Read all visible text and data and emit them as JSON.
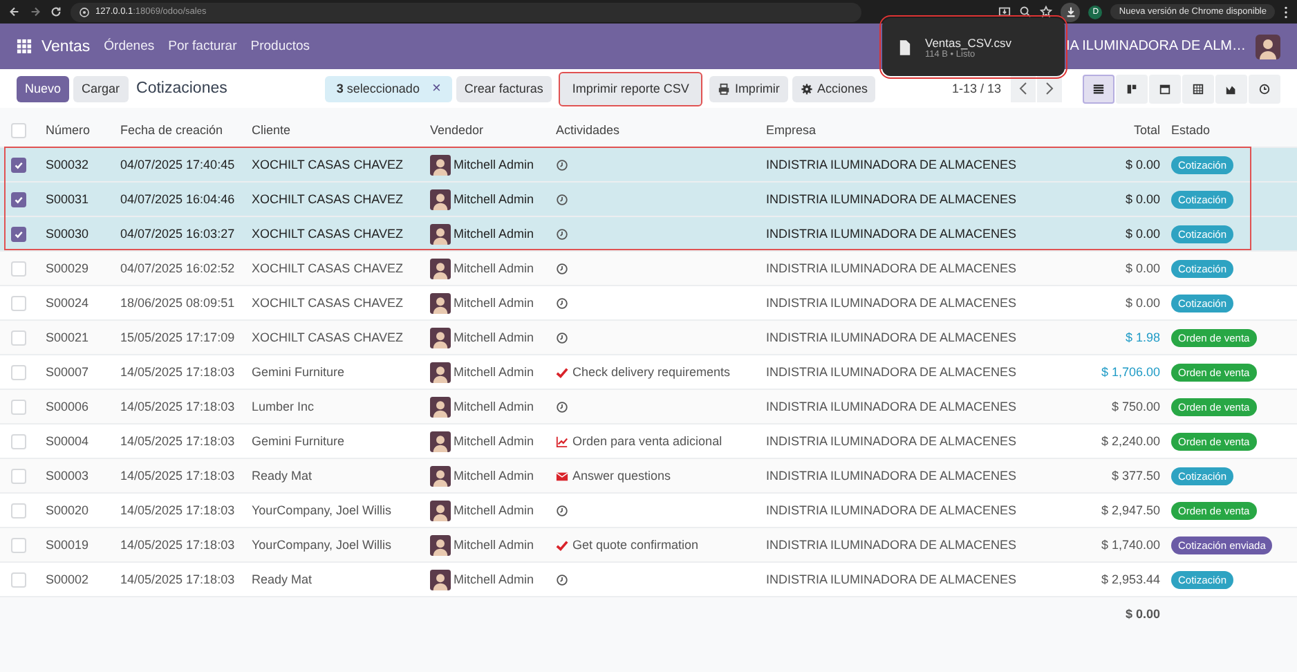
{
  "browser": {
    "url_host": "127.0.0.1",
    "url_path": ":18069/odoo/sales",
    "profile_initial": "D",
    "update_notice": "Nueva versión de Chrome disponible"
  },
  "download_popup": {
    "file_name": "Ventas_CSV.csv",
    "details": "114 B • Listo",
    "highlight": true
  },
  "navbar": {
    "app": "Ventas",
    "menu": [
      "Órdenes",
      "Por facturar",
      "Productos"
    ],
    "company": "IA ILUMINADORA DE ALM…"
  },
  "control_panel": {
    "buttons": [
      {
        "label": "Nuevo",
        "kind": "primary"
      },
      {
        "label": "Cargar",
        "kind": "secondary"
      }
    ],
    "title": "Cotizaciones",
    "selection": "**3** seleccionado",
    "clear": "×",
    "actions": [
      {
        "label": "Crear facturas",
        "kind": "plain",
        "highlight": false
      },
      {
        "label": "Imprimir reporte CSV",
        "kind": "plain",
        "highlight": true
      },
      {
        "label": "Imprimir",
        "kind": "print",
        "highlight": false
      },
      {
        "label": "Acciones",
        "kind": "menu",
        "highlight": false
      }
    ],
    "pager": "1-13 / 13",
    "views": [
      {
        "kind": "list",
        "selected": true
      },
      {
        "kind": "kanban",
        "selected": false
      },
      {
        "kind": "calendar",
        "selected": false
      },
      {
        "kind": "pivot",
        "selected": false
      },
      {
        "kind": "graph",
        "selected": false
      },
      {
        "kind": "activity",
        "selected": false
      }
    ]
  },
  "table": {
    "columns": [
      "Número",
      "Fecha de creación",
      "Cliente",
      "Vendedor",
      "Actividades",
      "Empresa",
      "Total",
      "Estado"
    ],
    "highlight_selected": true,
    "all_selected": false,
    "rows": [
      {
        "selected": true,
        "number": "S00032",
        "date": "04/07/2025 17:40:45",
        "customer": "XOCHILT CASAS CHAVEZ",
        "salesperson": "Mitchell Admin",
        "activity": {
          "kind": "clock"
        },
        "company": "INDISTRIA ILUMINADORA DE ALMACENES",
        "total": "$ 0.00",
        "total_emphasis": false,
        "status": {
          "label": "Cotización",
          "color": "#2ea3c2"
        }
      },
      {
        "selected": true,
        "number": "S00031",
        "date": "04/07/2025 16:04:46",
        "customer": "XOCHILT CASAS CHAVEZ",
        "salesperson": "Mitchell Admin",
        "activity": {
          "kind": "clock"
        },
        "company": "INDISTRIA ILUMINADORA DE ALMACENES",
        "total": "$ 0.00",
        "total_emphasis": false,
        "status": {
          "label": "Cotización",
          "color": "#2ea3c2"
        }
      },
      {
        "selected": true,
        "number": "S00030",
        "date": "04/07/2025 16:03:27",
        "customer": "XOCHILT CASAS CHAVEZ",
        "salesperson": "Mitchell Admin",
        "activity": {
          "kind": "clock"
        },
        "company": "INDISTRIA ILUMINADORA DE ALMACENES",
        "total": "$ 0.00",
        "total_emphasis": false,
        "status": {
          "label": "Cotización",
          "color": "#2ea3c2"
        }
      },
      {
        "selected": false,
        "number": "S00029",
        "date": "04/07/2025 16:02:52",
        "customer": "XOCHILT CASAS CHAVEZ",
        "salesperson": "Mitchell Admin",
        "activity": {
          "kind": "clock"
        },
        "company": "INDISTRIA ILUMINADORA DE ALMACENES",
        "total": "$ 0.00",
        "total_emphasis": false,
        "status": {
          "label": "Cotización",
          "color": "#2ea3c2"
        }
      },
      {
        "selected": false,
        "number": "S00024",
        "date": "18/06/2025 08:09:51",
        "customer": "XOCHILT CASAS CHAVEZ",
        "salesperson": "Mitchell Admin",
        "activity": {
          "kind": "clock"
        },
        "company": "INDISTRIA ILUMINADORA DE ALMACENES",
        "total": "$ 0.00",
        "total_emphasis": false,
        "status": {
          "label": "Cotización",
          "color": "#2ea3c2"
        }
      },
      {
        "selected": false,
        "number": "S00021",
        "date": "15/05/2025 17:17:09",
        "customer": "XOCHILT CASAS CHAVEZ",
        "salesperson": "Mitchell Admin",
        "activity": {
          "kind": "clock"
        },
        "company": "INDISTRIA ILUMINADORA DE ALMACENES",
        "total": "$ 1.98",
        "total_emphasis": true,
        "status": {
          "label": "Orden de venta",
          "color": "#28a745"
        }
      },
      {
        "selected": false,
        "number": "S00007",
        "date": "14/05/2025 17:18:03",
        "customer": "Gemini Furniture",
        "salesperson": "Mitchell Admin",
        "activity": {
          "kind": "check",
          "text": "Check delivery requirements"
        },
        "company": "INDISTRIA ILUMINADORA DE ALMACENES",
        "total": "$ 1,706.00",
        "total_emphasis": true,
        "status": {
          "label": "Orden de venta",
          "color": "#28a745"
        }
      },
      {
        "selected": false,
        "number": "S00006",
        "date": "14/05/2025 17:18:03",
        "customer": "Lumber Inc",
        "salesperson": "Mitchell Admin",
        "activity": {
          "kind": "clock"
        },
        "company": "INDISTRIA ILUMINADORA DE ALMACENES",
        "total": "$ 750.00",
        "total_emphasis": false,
        "status": {
          "label": "Orden de venta",
          "color": "#28a745"
        }
      },
      {
        "selected": false,
        "number": "S00004",
        "date": "14/05/2025 17:18:03",
        "customer": "Gemini Furniture",
        "salesperson": "Mitchell Admin",
        "activity": {
          "kind": "chart",
          "text": "Orden para venta adicional"
        },
        "company": "INDISTRIA ILUMINADORA DE ALMACENES",
        "total": "$ 2,240.00",
        "total_emphasis": false,
        "status": {
          "label": "Orden de venta",
          "color": "#28a745"
        }
      },
      {
        "selected": false,
        "number": "S00003",
        "date": "14/05/2025 17:18:03",
        "customer": "Ready Mat",
        "salesperson": "Mitchell Admin",
        "activity": {
          "kind": "mail",
          "text": "Answer questions"
        },
        "company": "INDISTRIA ILUMINADORA DE ALMACENES",
        "total": "$ 377.50",
        "total_emphasis": false,
        "status": {
          "label": "Cotización",
          "color": "#2ea3c2"
        }
      },
      {
        "selected": false,
        "number": "S00020",
        "date": "14/05/2025 17:18:03",
        "customer": "YourCompany, Joel Willis",
        "salesperson": "Mitchell Admin",
        "activity": {
          "kind": "clock"
        },
        "company": "INDISTRIA ILUMINADORA DE ALMACENES",
        "total": "$ 2,947.50",
        "total_emphasis": false,
        "status": {
          "label": "Orden de venta",
          "color": "#28a745"
        }
      },
      {
        "selected": false,
        "number": "S00019",
        "date": "14/05/2025 17:18:03",
        "customer": "YourCompany, Joel Willis",
        "salesperson": "Mitchell Admin",
        "activity": {
          "kind": "check",
          "text": "Get quote confirmation"
        },
        "company": "INDISTRIA ILUMINADORA DE ALMACENES",
        "total": "$ 1,740.00",
        "total_emphasis": false,
        "status": {
          "label": "Cotización enviada",
          "color": "#6b5ba6"
        }
      },
      {
        "selected": false,
        "number": "S00002",
        "date": "14/05/2025 17:18:03",
        "customer": "Ready Mat",
        "salesperson": "Mitchell Admin",
        "activity": {
          "kind": "clock"
        },
        "company": "INDISTRIA ILUMINADORA DE ALMACENES",
        "total": "$ 2,953.44",
        "total_emphasis": false,
        "status": {
          "label": "Cotización",
          "color": "#2ea3c2"
        }
      }
    ],
    "footer_total": "$ 0.00"
  }
}
